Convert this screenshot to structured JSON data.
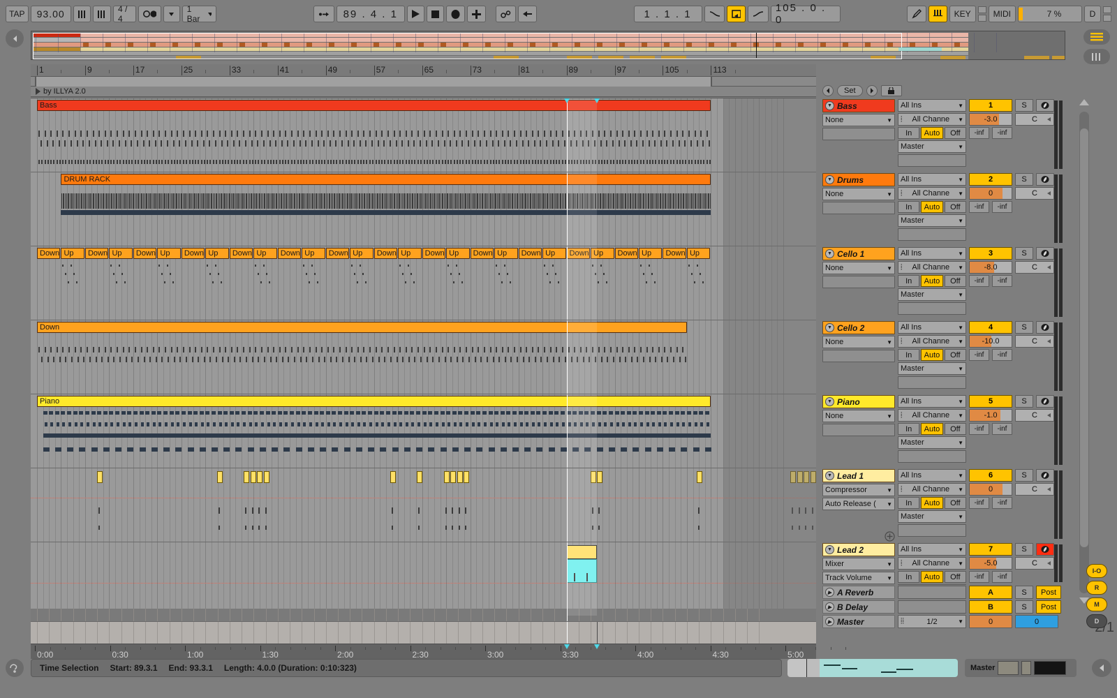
{
  "toolbar": {
    "tap_label": "TAP",
    "tempo": "93.00",
    "metronome_icon": "metronome-icon",
    "nudge_icon": "nudge-icon",
    "time_signature": "4 / 4",
    "follow_icon": "follow-icon",
    "quantization": "1 Bar",
    "punch_in_icon": "punch-in-icon",
    "position": "89 . 4 . 1",
    "play_icon": "play-icon",
    "stop_icon": "stop-icon",
    "record_icon": "record-icon",
    "overdub_icon": "overdub-icon",
    "link_icon": "link-icon",
    "back_icon": "back-arrow-icon",
    "loop_start": "1 . 1 . 1",
    "punch_in_toggle_icon": "punch-curve-in-icon",
    "loop_toggle_icon": "loop-icon",
    "punch_out_toggle_icon": "punch-curve-out-icon",
    "loop_length": "105 . 0 . 0",
    "draw_icon": "pencil-icon",
    "keyboard_icon": "computer-midi-keyboard-icon",
    "key_label": "KEY",
    "midi_label": "MIDI",
    "cpu_load": "7 %",
    "disk_label": "D"
  },
  "timeline": {
    "bar_labels": [
      "1",
      "9",
      "17",
      "25",
      "33",
      "41",
      "49",
      "57",
      "65",
      "73",
      "81",
      "89",
      "97",
      "105",
      "113"
    ],
    "scene_marker": "by ILLYA 2.0",
    "time_labels": [
      "0:00",
      "0:30",
      "1:00",
      "1:30",
      "2:00",
      "2:30",
      "3:00",
      "3:30",
      "4:00",
      "4:30",
      "5:00"
    ],
    "time_signature_display": "2/1"
  },
  "tracks": [
    {
      "name": "Bass",
      "color": "#f03a1e",
      "clip_label": "Bass",
      "number": "1",
      "monitor_source": "All Ins",
      "device": "None",
      "channel": "All Channe",
      "monitor": [
        "In",
        "Auto",
        "Off"
      ],
      "monitor_active": "Auto",
      "output": "Master",
      "volume": "-3.0",
      "pan": "C",
      "solo": "S",
      "arm": "arm-icon",
      "arm_active": false,
      "meter_left": "-inf",
      "meter_right": "-inf"
    },
    {
      "name": "Drums",
      "color": "#ff7a0d",
      "clip_label": "DRUM RACK",
      "number": "2",
      "monitor_source": "All Ins",
      "device": "None",
      "channel": "All Channe",
      "monitor": [
        "In",
        "Auto",
        "Off"
      ],
      "monitor_active": "Auto",
      "output": "Master",
      "volume": "0",
      "pan": "C",
      "solo": "S",
      "arm": "arm-icon",
      "arm_active": false,
      "meter_left": "-inf",
      "meter_right": "-inf"
    },
    {
      "name": "Cello 1",
      "color": "#ffa21e",
      "clip_label": "Down",
      "clip_label_alt": "Up",
      "number": "3",
      "monitor_source": "All Ins",
      "device": "None",
      "channel": "All Channe",
      "monitor": [
        "In",
        "Auto",
        "Off"
      ],
      "monitor_active": "Auto",
      "output": "Master",
      "volume": "-8.0",
      "pan": "C",
      "solo": "S",
      "arm": "arm-icon",
      "arm_active": false,
      "meter_left": "-inf",
      "meter_right": "-inf"
    },
    {
      "name": "Cello 2",
      "color": "#ffa21e",
      "clip_label": "Down",
      "number": "4",
      "monitor_source": "All Ins",
      "device": "None",
      "channel": "All Channe",
      "monitor": [
        "In",
        "Auto",
        "Off"
      ],
      "monitor_active": "Auto",
      "output": "Master",
      "volume": "-10.0",
      "pan": "C",
      "solo": "S",
      "arm": "arm-icon",
      "arm_active": false,
      "meter_left": "-inf",
      "meter_right": "-inf"
    },
    {
      "name": "Piano",
      "color": "#ffe92a",
      "clip_label": "Piano",
      "number": "5",
      "monitor_source": "All Ins",
      "device": "None",
      "channel": "All Channe",
      "monitor": [
        "In",
        "Auto",
        "Off"
      ],
      "monitor_active": "Auto",
      "output": "Master",
      "volume": "-1.0",
      "pan": "C",
      "solo": "S",
      "arm": "arm-icon",
      "arm_active": false,
      "meter_left": "-inf",
      "meter_right": "-inf"
    },
    {
      "name": "Lead 1",
      "color": "#ffeda0",
      "clip_label": "",
      "number": "6",
      "monitor_source": "All Ins",
      "device": "Compressor",
      "device2": "Auto Release (",
      "channel": "All Channe",
      "monitor": [
        "In",
        "Auto",
        "Off"
      ],
      "monitor_active": "Auto",
      "output": "Master",
      "volume": "0",
      "pan": "C",
      "solo": "S",
      "arm": "arm-icon",
      "arm_active": false,
      "meter_left": "-inf",
      "meter_right": "-inf",
      "add_device_icon": "plus-circle-icon"
    },
    {
      "name": "Lead 2",
      "color": "#ffeda0",
      "clip_label": "",
      "number": "7",
      "monitor_source": "All Ins",
      "device": "Mixer",
      "device2": "Track Volume",
      "channel": "All Channe",
      "monitor": [
        "In",
        "Auto",
        "Off"
      ],
      "monitor_active": "Auto",
      "output": "Master",
      "volume": "-5.0",
      "pan": "C",
      "solo": "S",
      "arm": "arm-icon",
      "arm_active": true,
      "meter_left": "-inf",
      "meter_right": "-inf"
    }
  ],
  "returns": [
    {
      "name": "A Reverb",
      "letter": "A",
      "solo": "S",
      "mode": "Post"
    },
    {
      "name": "B Delay",
      "letter": "B",
      "solo": "S",
      "mode": "Post"
    }
  ],
  "master": {
    "name": "Master",
    "crossfade": "1/2",
    "volume": "0",
    "cue": "0"
  },
  "status": {
    "label": "Time Selection",
    "start_label": "Start: 89.3.1",
    "end_label": "End: 93.3.1",
    "length_label": "Length: 4.0.0  (Duration: 0:10:323)"
  },
  "browser": {
    "master_label": "Master",
    "hamburger_icon": "hamburger-icon",
    "keys_icon": "piano-keys-icon",
    "io_button": "I-O",
    "r_button": "R",
    "m_button": "M",
    "d_button": "D",
    "collapse_icon": "collapse-left-icon",
    "expand_icon": "expand-icon"
  }
}
